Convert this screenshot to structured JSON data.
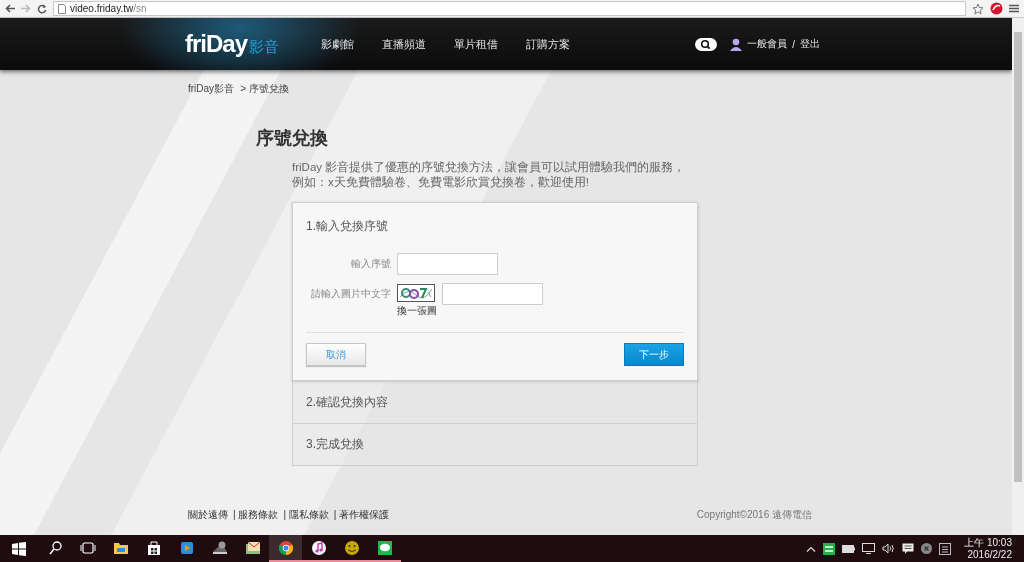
{
  "browser": {
    "url_host": "video.friday.tw",
    "url_path": "/sn"
  },
  "header": {
    "logo": "friDay",
    "logo_suffix": "影音",
    "nav": [
      {
        "label": "影劇館"
      },
      {
        "label": "直播頻道"
      },
      {
        "label": "單片租借"
      },
      {
        "label": "訂購方案"
      }
    ],
    "member": "一般會員",
    "separator": "/",
    "logout": "登出"
  },
  "breadcrumb": [
    {
      "label": "friDay影音"
    },
    {
      "label": "> 序號兌換"
    }
  ],
  "page_title": "序號兌換",
  "intro": [
    "friDay 影音提供了優惠的序號兌換方法，讓會員可以試用體驗我們的服務，",
    "例如：x天免費體驗卷、免費電影欣賞兌換卷，歡迎使用!"
  ],
  "steps": [
    {
      "title": "1.輸入兌換序號",
      "expanded": true,
      "fields": [
        {
          "kind": "text",
          "label": "輸入序號"
        },
        {
          "kind": "captcha",
          "label": "請輸入圖片中文字",
          "refresh": "換一張圖"
        }
      ],
      "buttons": [
        {
          "label": "取消",
          "kind": "secondary"
        },
        {
          "label": "下一步",
          "kind": "primary"
        }
      ]
    },
    {
      "title": "2.確認兌換內容",
      "expanded": false
    },
    {
      "title": "3.完成兌換",
      "expanded": false
    }
  ],
  "footer": {
    "links": [
      {
        "label": "關於遠傳"
      },
      {
        "label": "| 服務條款"
      },
      {
        "label": "| 隱私條款"
      },
      {
        "label": "| 著作權保護"
      }
    ],
    "copyright": "Copyright©2016 遠傳電信"
  },
  "taskbar": {
    "apps": [
      {
        "kind": "search",
        "running": false,
        "active": false
      },
      {
        "kind": "taskview",
        "running": false,
        "active": false
      },
      {
        "kind": "folder",
        "running": false,
        "active": false
      },
      {
        "kind": "store",
        "running": false,
        "active": false
      },
      {
        "kind": "player",
        "running": false,
        "active": false
      },
      {
        "kind": "camera",
        "running": false,
        "active": false
      },
      {
        "kind": "mail",
        "running": false,
        "active": false
      },
      {
        "kind": "chrome",
        "running": true,
        "active": true
      },
      {
        "kind": "music",
        "running": true,
        "active": false
      },
      {
        "kind": "smiley",
        "running": true,
        "active": false
      },
      {
        "kind": "chat",
        "running": true,
        "active": false
      }
    ],
    "time": "上午 10:03",
    "date": "2016/2/22"
  }
}
